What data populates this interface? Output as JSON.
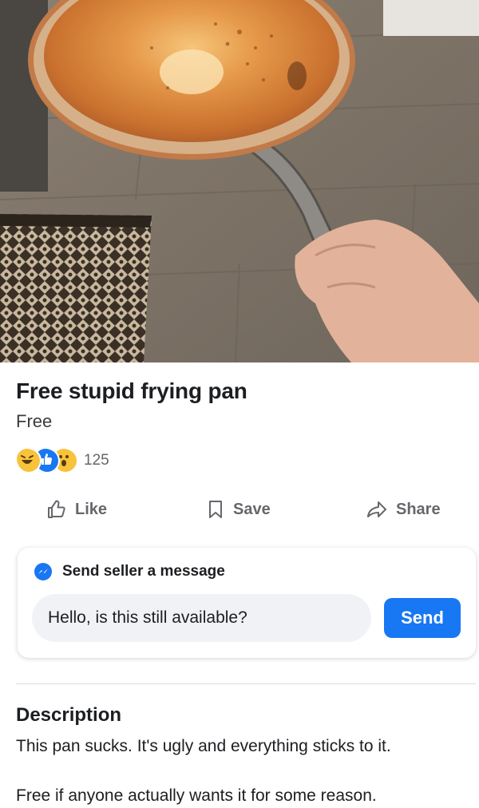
{
  "listing": {
    "title": "Free stupid frying pan",
    "price": "Free",
    "reactions": {
      "icons": [
        "haha-emoji-icon",
        "like-reaction-icon",
        "wow-emoji-icon"
      ],
      "count": "125"
    }
  },
  "actions": {
    "like_label": "Like",
    "save_label": "Save",
    "share_label": "Share"
  },
  "message": {
    "header": "Send seller a message",
    "input_value": "Hello, is this still available?",
    "send_label": "Send"
  },
  "description": {
    "heading": "Description",
    "line1": "This pan sucks. It's ugly and everything sticks to it.",
    "line2": "Free if anyone actually wants it for some reason."
  },
  "colors": {
    "accent": "#1877f2",
    "input_bg": "#f0f2f5",
    "muted_text": "#65676b"
  }
}
